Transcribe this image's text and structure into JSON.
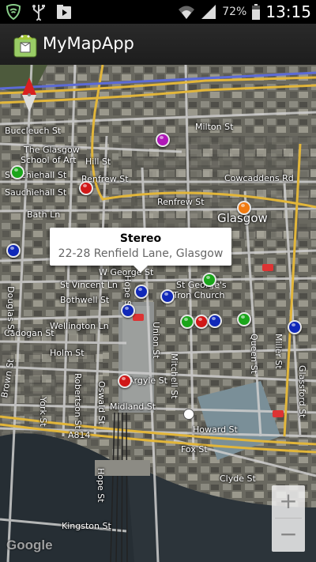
{
  "status_bar": {
    "battery_percent": "72%",
    "time": "13:15",
    "icons": [
      "shield-icon",
      "usb-icon",
      "media-play-icon",
      "wifi-icon",
      "signal-icon",
      "battery-icon"
    ]
  },
  "action_bar": {
    "app_title": "MyMapApp",
    "app_icon": "android-icon"
  },
  "map": {
    "labels": {
      "buccleuch_st": "Buccleuch St",
      "glasgow_school_of_art_1": "The Glasgow",
      "glasgow_school_of_art_2": "School of Art",
      "sauchiehall_st_1": "Sauchiehall St",
      "sauchiehall_st_2": "Sauchiehall St",
      "bath_ln": "Bath Ln",
      "renfrew_st_1": "Renfrew St",
      "renfrew_st_2": "Renfrew St",
      "hill_st": "Hill St",
      "milton_st": "Milton St",
      "cowcaddens_rd": "Cowcaddens Rd",
      "glasgow": "Glasgow",
      "w_george_st": "W George St",
      "st_vincent_ln": "St Vincent Ln",
      "bothwell_st": "Bothwell St",
      "st_georges_1": "St George's",
      "st_georges_2": "Tron Church",
      "wellington_ln": "Wellington Ln",
      "cadogan_st": "Cadogan St",
      "holm_st": "Holm St",
      "argyle_st": "Argyle St",
      "hope_st": "Hope St",
      "union_st": "Union St",
      "mitchell_st": "Mitchell St",
      "queen_st": "Queen St",
      "miller_st": "Miller St",
      "glassford_st": "Glassford St",
      "midland_st": "Midland St",
      "york_st": "York St",
      "robertson_st": "Robertson St",
      "oswald_st": "Oswald St",
      "douglas_st": "Douglas St",
      "brown_st": "Brown St",
      "a814": "A814",
      "howard_st": "Howard St",
      "fox_st": "Fox St",
      "clyde_st": "Clyde St",
      "kingston_st": "Kingston St",
      "hope_st_2": "Hope St"
    },
    "info_window": {
      "title": "Stereo",
      "snippet": "22-28 Renfield Lane, Glasgow"
    },
    "zoom": {
      "in_label": "+",
      "out_label": "−"
    },
    "logo": "Google",
    "marker_colors": {
      "green": "#1aa51a",
      "red": "#d01818",
      "blue": "#1028b8",
      "purple": "#b017b8",
      "orange": "#f07a10"
    }
  }
}
